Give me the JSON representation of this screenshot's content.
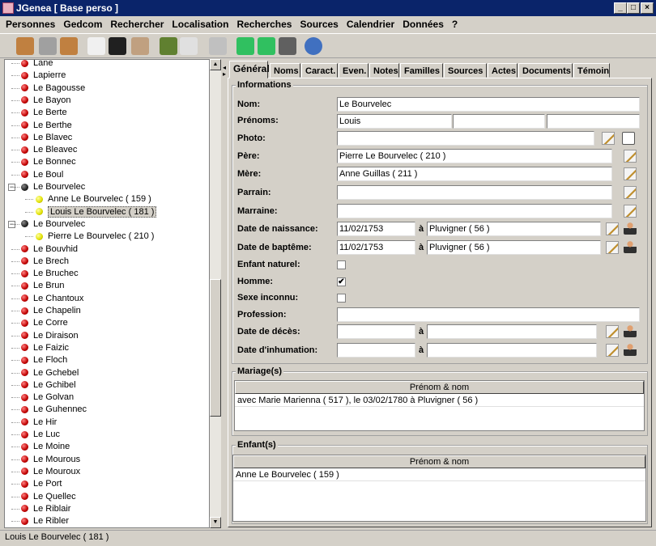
{
  "window": {
    "title": "JGenea [ Base perso ]",
    "minimize": "_",
    "maximize": "□",
    "close": "×"
  },
  "menu": [
    "Personnes",
    "Gedcom",
    "Rechercher",
    "Localisation",
    "Recherches",
    "Sources",
    "Calendrier",
    "Données",
    "?"
  ],
  "toolbar": [
    {
      "icon": "add-person-icon",
      "color": "#c08040"
    },
    {
      "icon": "person-disabled-icon",
      "color": "#a0a0a0"
    },
    {
      "icon": "remove-person-icon",
      "color": "#c08040"
    },
    {
      "icon": "search-document-icon",
      "color": "#f0f0f0"
    },
    {
      "icon": "tree-icon",
      "color": "#202020"
    },
    {
      "icon": "papers-icon",
      "color": "#c0a080"
    },
    {
      "icon": "books-icon",
      "color": "#608030"
    },
    {
      "icon": "notes-icon",
      "color": "#e0e0e0"
    },
    {
      "icon": "calendar-icon",
      "color": "#c0c0c0"
    },
    {
      "icon": "export-truck-icon",
      "color": "#30c060"
    },
    {
      "icon": "import-truck-icon",
      "color": "#30c060"
    },
    {
      "icon": "tool-icon",
      "color": "#606060"
    },
    {
      "icon": "info-icon",
      "color": "#4070c0"
    }
  ],
  "tree": [
    {
      "label": "Lane",
      "type": "red"
    },
    {
      "label": "Lapierre",
      "type": "red"
    },
    {
      "label": "Le Bagousse",
      "type": "red"
    },
    {
      "label": "Le Bayon",
      "type": "red"
    },
    {
      "label": "Le Berte",
      "type": "red"
    },
    {
      "label": "Le Berthe",
      "type": "red"
    },
    {
      "label": "Le Blavec",
      "type": "red"
    },
    {
      "label": "Le Bleavec",
      "type": "red"
    },
    {
      "label": "Le Bonnec",
      "type": "red"
    },
    {
      "label": "Le Boul",
      "type": "red"
    },
    {
      "label": "Le Bourvelec",
      "type": "blk",
      "expanded": true
    },
    {
      "label": "Anne Le Bourvelec ( 159 )",
      "type": "yel",
      "child": true
    },
    {
      "label": "Louis Le Bourvelec ( 181 )",
      "type": "yel",
      "child": true,
      "selected": true
    },
    {
      "label": "Le Bourvelec",
      "type": "blk",
      "expanded": true
    },
    {
      "label": "Pierre Le Bourvelec ( 210 )",
      "type": "yel",
      "child": true
    },
    {
      "label": "Le Bouvhid",
      "type": "red"
    },
    {
      "label": "Le Brech",
      "type": "red"
    },
    {
      "label": "Le Bruchec",
      "type": "red"
    },
    {
      "label": "Le Brun",
      "type": "red"
    },
    {
      "label": "Le Chantoux",
      "type": "red"
    },
    {
      "label": "Le Chapelin",
      "type": "red"
    },
    {
      "label": "Le Corre",
      "type": "red"
    },
    {
      "label": "Le Diraison",
      "type": "red"
    },
    {
      "label": "Le Faizic",
      "type": "red"
    },
    {
      "label": "Le Floch",
      "type": "red"
    },
    {
      "label": "Le Gchebel",
      "type": "red"
    },
    {
      "label": "Le Gchibel",
      "type": "red"
    },
    {
      "label": "Le Golvan",
      "type": "red"
    },
    {
      "label": "Le Guhennec",
      "type": "red"
    },
    {
      "label": "Le Hir",
      "type": "red"
    },
    {
      "label": "Le Luc",
      "type": "red"
    },
    {
      "label": "Le Moine",
      "type": "red"
    },
    {
      "label": "Le Mourous",
      "type": "red"
    },
    {
      "label": "Le Mouroux",
      "type": "red"
    },
    {
      "label": "Le Port",
      "type": "red"
    },
    {
      "label": "Le Quellec",
      "type": "red"
    },
    {
      "label": "Le Riblair",
      "type": "red"
    },
    {
      "label": "Le Ribler",
      "type": "red"
    }
  ],
  "status": "Louis Le Bourvelec ( 181 )",
  "tabs": [
    "Général",
    "Noms",
    "Caract.",
    "Even.",
    "Notes",
    "Familles",
    "Sources",
    "Actes",
    "Documents",
    "Témoin"
  ],
  "informations": {
    "title": "Informations",
    "nom": {
      "label": "Nom:",
      "value": "Le Bourvelec"
    },
    "prenoms": {
      "label": "Prénoms:",
      "values": [
        "Louis",
        "",
        ""
      ]
    },
    "photo": {
      "label": "Photo:",
      "value": ""
    },
    "pere": {
      "label": "Père:",
      "value": "Pierre Le Bourvelec ( 210 )"
    },
    "mere": {
      "label": "Mère:",
      "value": "Anne Guillas ( 211 )"
    },
    "parrain": {
      "label": "Parrain:",
      "value": ""
    },
    "marraine": {
      "label": "Marraine:",
      "value": ""
    },
    "naissance": {
      "label": "Date de naissance:",
      "date": "11/02/1753",
      "a": "à",
      "lieu": "Pluvigner ( 56 )"
    },
    "bapteme": {
      "label": "Date de baptême:",
      "date": "11/02/1753",
      "a": "à",
      "lieu": "Pluvigner ( 56 )"
    },
    "enfant_naturel": {
      "label": "Enfant naturel:",
      "checked": false
    },
    "homme": {
      "label": "Homme:",
      "checked": true,
      "mark": "✔"
    },
    "sexe_inconnu": {
      "label": "Sexe inconnu:",
      "checked": false
    },
    "profession": {
      "label": "Profession:",
      "value": ""
    },
    "deces": {
      "label": "Date de décès:",
      "date": "",
      "a": "à",
      "lieu": ""
    },
    "inhumation": {
      "label": "Date d'inhumation:",
      "date": "",
      "a": "à",
      "lieu": ""
    }
  },
  "mariages": {
    "title": "Mariage(s)",
    "header": "Prénom & nom",
    "rows": [
      "avec Marie Marienna ( 517 ), le 03/02/1780 à Pluvigner ( 56 )"
    ]
  },
  "enfants": {
    "title": "Enfant(s)",
    "header": "Prénom & nom",
    "rows": [
      "Anne Le Bourvelec ( 159 )"
    ]
  }
}
